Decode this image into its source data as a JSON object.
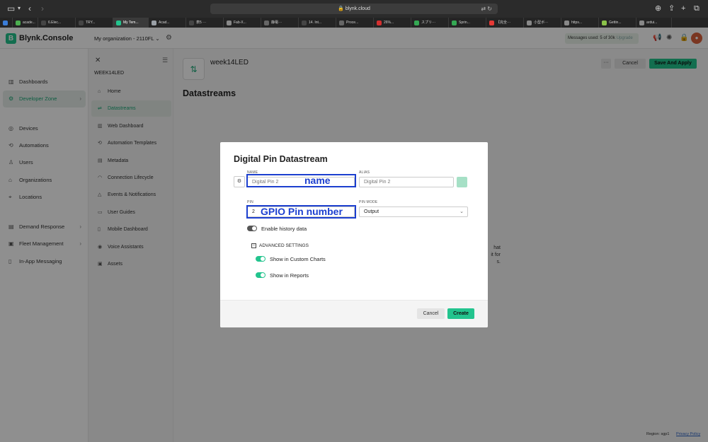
{
  "browser": {
    "url": "blynk.cloud",
    "tabs": [
      {
        "label": "",
        "color": "#3b7dd8"
      },
      {
        "label": "acade...",
        "color": "#4caf50"
      },
      {
        "label": "6.Elec...",
        "color": "#444444"
      },
      {
        "label": "TRY...",
        "color": "#444444"
      },
      {
        "label": "My Tem...",
        "color": "#23c48e"
      },
      {
        "label": "Acad...",
        "color": "#9aa0a6"
      },
      {
        "label": "表5 ···",
        "color": "#444444"
      },
      {
        "label": "Fab-X...",
        "color": "#888888"
      },
      {
        "label": "静電···",
        "color": "#666666"
      },
      {
        "label": "14. Int...",
        "color": "#444444"
      },
      {
        "label": "Proce...",
        "color": "#666666"
      },
      {
        "label": "26%...",
        "color": "#d32f2f"
      },
      {
        "label": "スプリ···",
        "color": "#34a853"
      },
      {
        "label": "Sprin...",
        "color": "#34a853"
      },
      {
        "label": "【完全···",
        "color": "#e53935"
      },
      {
        "label": "小型ボ···",
        "color": "#888888"
      },
      {
        "label": "https...",
        "color": "#888888"
      },
      {
        "label": "Gettin...",
        "color": "#8bc34a"
      },
      {
        "label": "ardui...",
        "color": "#888888"
      }
    ]
  },
  "header": {
    "logo_letter": "B",
    "app_name": "Blynk.Console",
    "organization": "My organization - 2110FL",
    "messages": "Messages used: 5 of 30k",
    "messages_link": "Upgrade",
    "avatar_initial": "●"
  },
  "sidebar": {
    "items": [
      {
        "label": "Dashboards",
        "icon": "chart-icon"
      },
      {
        "label": "Developer Zone",
        "icon": "developer-icon"
      },
      {
        "label": "Devices",
        "icon": "devices-icon"
      },
      {
        "label": "Automations",
        "icon": "automation-icon"
      },
      {
        "label": "Users",
        "icon": "users-icon"
      },
      {
        "label": "Organizations",
        "icon": "organization-icon"
      },
      {
        "label": "Locations",
        "icon": "location-icon"
      },
      {
        "label": "Demand Response",
        "icon": "demand-icon"
      },
      {
        "label": "Fleet Management",
        "icon": "fleet-icon"
      },
      {
        "label": "In-App Messaging",
        "icon": "message-icon"
      }
    ]
  },
  "submenu": {
    "title": "WEEK14LED",
    "items": [
      {
        "label": "Home"
      },
      {
        "label": "Datastreams"
      },
      {
        "label": "Web Dashboard"
      },
      {
        "label": "Automation Templates"
      },
      {
        "label": "Metadata"
      },
      {
        "label": "Connection Lifecycle"
      },
      {
        "label": "Events & Notifications"
      },
      {
        "label": "User Guides"
      },
      {
        "label": "Mobile Dashboard"
      },
      {
        "label": "Voice Assistants"
      },
      {
        "label": "Assets"
      }
    ]
  },
  "main": {
    "template_name": "week14LED",
    "more_label": "···",
    "cancel_label": "Cancel",
    "save_label": "Save And Apply",
    "heading": "Datastreams",
    "bg_text_1": "hat",
    "bg_text_2": "it for",
    "bg_text_3": "s."
  },
  "modal": {
    "title": "Digital Pin Datastream",
    "name_label": "NAME",
    "name_value": "Digital Pin 2",
    "alias_label": "ALIAS",
    "alias_value": "Digital Pin 2",
    "pin_label": "PIN",
    "pin_value": "2",
    "pin_mode_label": "PIN MODE",
    "pin_mode_value": "Output",
    "history_label": "Enable history data",
    "history_enabled": false,
    "advanced_label": "ADVANCED SETTINGS",
    "custom_charts_label": "Show in Custom Charts",
    "custom_charts_enabled": true,
    "reports_label": "Show in Reports",
    "reports_enabled": true,
    "cancel_label": "Cancel",
    "create_label": "Create",
    "swatch_color": "#a6e0c6"
  },
  "annotations": {
    "name_note": "name",
    "pin_note": "GPIO Pin number",
    "color": "#1c3fcf"
  },
  "footer": {
    "region": "Region: sgp1",
    "privacy": "Privacy Policy"
  }
}
